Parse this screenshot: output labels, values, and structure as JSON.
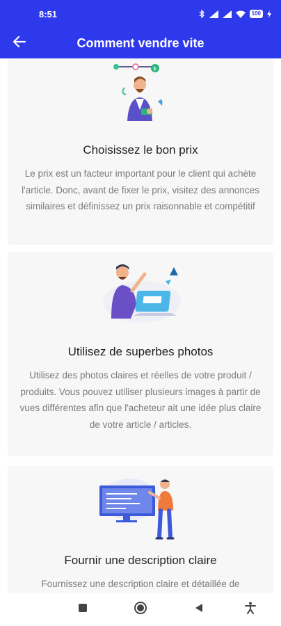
{
  "status_bar": {
    "time": "8:51",
    "battery": "100",
    "icons": [
      "bluetooth-icon",
      "signal-icon",
      "signal-icon",
      "wifi-icon",
      "battery-icon",
      "charging-icon"
    ]
  },
  "app_bar": {
    "title": "Comment vendre vite",
    "back_icon": "arrow-left-icon"
  },
  "cards": [
    {
      "illustration": "price-illustration",
      "title": "Choisissez le bon prix",
      "text": "Le prix est un facteur important pour le client qui achète l'article. Donc, avant de fixer le prix, visitez des annonces similaires et définissez un prix raisonnable et compétitif"
    },
    {
      "illustration": "photo-illustration",
      "title": "Utilisez de superbes photos",
      "text": "Utilisez des photos claires et réelles de votre produit / produits. Vous pouvez utiliser plusieurs images à partir de vues différentes afin que l'acheteur ait une idée plus claire de votre article / articles."
    },
    {
      "illustration": "description-illustration",
      "title": "Fournir une description claire",
      "text": "Fournissez une description claire et détaillée de"
    }
  ],
  "nav_bar": {
    "buttons": [
      "recents-icon",
      "home-icon",
      "back-icon",
      "accessibility-icon"
    ]
  },
  "colors": {
    "primary": "#2f39ec",
    "card_bg": "#f7f7f7",
    "body_text": "#7a7a7a",
    "title_text": "#1f1f1f"
  }
}
